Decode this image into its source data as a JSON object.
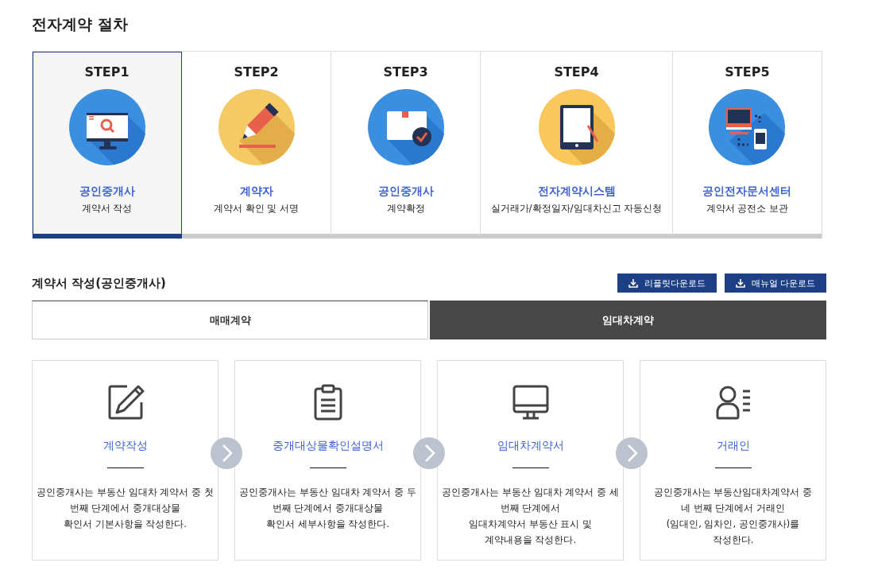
{
  "page_title": "전자계약 절차",
  "steps": [
    {
      "step": "STEP1",
      "actor": "공인중개사",
      "task": "계약서 작성",
      "selected": true
    },
    {
      "step": "STEP2",
      "actor": "계약자",
      "task": "계약서 확인 및 서명",
      "selected": false
    },
    {
      "step": "STEP3",
      "actor": "공인중개사",
      "task": "계약확정",
      "selected": false
    },
    {
      "step": "STEP4",
      "actor": "전자계약시스템",
      "task": "실거래가/확정일자/임대차신고 자동신청",
      "selected": false
    },
    {
      "step": "STEP5",
      "actor": "공인전자문서센터",
      "task": "계약서 공전소 보관",
      "selected": false
    }
  ],
  "section": {
    "title": "계약서 작성(공인중개사)",
    "buttons": [
      "리플릿다운로드",
      "매뉴얼 다운로드"
    ]
  },
  "tabs": [
    {
      "label": "매매계약",
      "selected": false
    },
    {
      "label": "임대차계약",
      "selected": true
    }
  ],
  "cards": [
    {
      "title": "계약작성",
      "lines": [
        "공인중개사는 부동산 임대차 계약서 중 첫",
        "번째 단계에서 중개대상물",
        "확인서 기본사항을 작성한다."
      ]
    },
    {
      "title": "중개대상물확인설명서",
      "lines": [
        "공인중개사는 부동산 임대차 계약서 중 두",
        "번째 단계에서 중개대상물",
        "확인서 세부사항을 작성한다."
      ]
    },
    {
      "title": "임대차계약서",
      "lines": [
        "공인중개사는 부동산 임대차 계약서 중 세",
        "번째 단계에서",
        "임대차계약서 부동산 표시 및",
        "계약내용을 작성한다."
      ]
    },
    {
      "title": "거래인",
      "lines": [
        "공인중개사는 부동산임대차계약서 중",
        "네 번째 단계에서 거래인",
        "(임대인, 임차인, 공인중개사)를",
        "작성한다."
      ]
    }
  ]
}
